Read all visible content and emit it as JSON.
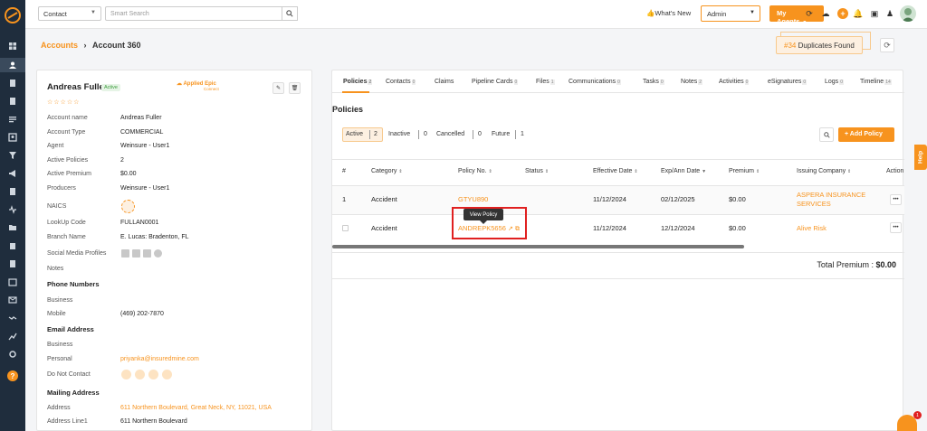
{
  "topbar": {
    "contact_select": "Contact",
    "search_placeholder": "Smart Search",
    "whats_new": "What's New",
    "admin_select": "Admin",
    "my_agents": "My Agents"
  },
  "breadcrumb": {
    "accounts": "Accounts",
    "current": "Account 360"
  },
  "duplicates": {
    "count": "#34",
    "label": "Duplicates Found"
  },
  "account": {
    "name": "Andreas Fuller",
    "status": "Active",
    "stars": "☆☆☆☆☆",
    "integration": "Applied Epic",
    "integration_sub": "Connect",
    "fields": [
      {
        "label": "Account name",
        "value": "Andreas Fuller"
      },
      {
        "label": "Account Type",
        "value": "COMMERCIAL"
      },
      {
        "label": "Agent",
        "value": "Weinsure - User1"
      },
      {
        "label": "Active Policies",
        "value": "2"
      },
      {
        "label": "Active Premium",
        "value": "$0.00"
      },
      {
        "label": "Producers",
        "value": "Weinsure - User1"
      },
      {
        "label": "NAICS",
        "value": ""
      },
      {
        "label": "LookUp Code",
        "value": "FULLAN0001"
      },
      {
        "label": "Branch Name",
        "value": "E. Lucas: Bradenton, FL"
      },
      {
        "label": "Social Media Profiles",
        "value": ""
      },
      {
        "label": "Notes",
        "value": ""
      }
    ],
    "phone_section": "Phone Numbers",
    "phones": [
      {
        "label": "Business",
        "value": ""
      },
      {
        "label": "Mobile",
        "value": "(469) 202-7870"
      }
    ],
    "email_section": "Email Address",
    "emails": [
      {
        "label": "Business",
        "value": ""
      },
      {
        "label": "Personal",
        "value": "priyanka@insuredmine.com"
      },
      {
        "label": "Do Not Contact",
        "value": ""
      }
    ],
    "mailing_section": "Mailing Address",
    "mailing": [
      {
        "label": "Address",
        "value": "611 Northern Boulevard, Great Neck, NY, 11021, USA"
      },
      {
        "label": "Address Line1",
        "value": "611 Northern Boulevard"
      }
    ]
  },
  "tabs": [
    {
      "label": "Policies",
      "count": "2"
    },
    {
      "label": "Contacts",
      "count": "0"
    },
    {
      "label": "Claims",
      "count": ""
    },
    {
      "label": "Pipeline Cards",
      "count": "0"
    },
    {
      "label": "Files",
      "count": "1"
    },
    {
      "label": "Communications",
      "count": "0"
    },
    {
      "label": "Tasks",
      "count": "0"
    },
    {
      "label": "Notes",
      "count": "2"
    },
    {
      "label": "Activities",
      "count": "0"
    },
    {
      "label": "eSignatures",
      "count": "0"
    },
    {
      "label": "Logs",
      "count": "0"
    },
    {
      "label": "Timeline",
      "count": "14"
    }
  ],
  "policies": {
    "title": "Policies",
    "filters": [
      {
        "label": "Active",
        "count": "2"
      },
      {
        "label": "Inactive",
        "count": "0"
      },
      {
        "label": "Cancelled",
        "count": "0"
      },
      {
        "label": "Future",
        "count": "1"
      }
    ],
    "add_button": "+ Add Policy",
    "columns": [
      "#",
      "Category",
      "Policy No.",
      "Status",
      "Effective Date",
      "Exp/Ann Date",
      "Premium",
      "Issuing Company",
      "Action"
    ],
    "rows": [
      {
        "num": "1",
        "category": "Accident",
        "policy_no": "GTYU890",
        "status": "",
        "effective": "11/12/2024",
        "exp": "02/12/2025",
        "premium": "$0.00",
        "company": "ASPERA INSURANCE SERVICES"
      },
      {
        "num": "",
        "category": "Accident",
        "policy_no": "ANDREPK5656",
        "status": "",
        "effective": "11/12/2024",
        "exp": "12/12/2024",
        "premium": "$0.00",
        "company": "Alive Risk"
      }
    ],
    "tooltip": "View Policy",
    "total_label": "Total Premium :",
    "total_value": "$0.00"
  },
  "help_tab": "Help",
  "chat_badge": "1"
}
